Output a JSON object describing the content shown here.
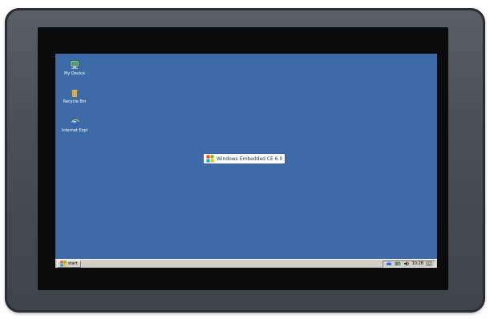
{
  "desktop": {
    "background_color": "#3e6aa7",
    "icons": [
      {
        "label": "My Device",
        "icon": "computer-icon"
      },
      {
        "label": "Recycle Bin",
        "icon": "trash-icon"
      },
      {
        "label": "Internet Explorer",
        "icon": "ie-icon"
      }
    ],
    "center_logo": {
      "text": "Windows Embedded CE 6.0",
      "icon": "windows-flag-icon"
    }
  },
  "taskbar": {
    "start_label": "start",
    "tray": {
      "time": "10:28",
      "icons": [
        "network-icon",
        "battery-icon",
        "speaker-icon",
        "keyboard-icon"
      ]
    }
  }
}
